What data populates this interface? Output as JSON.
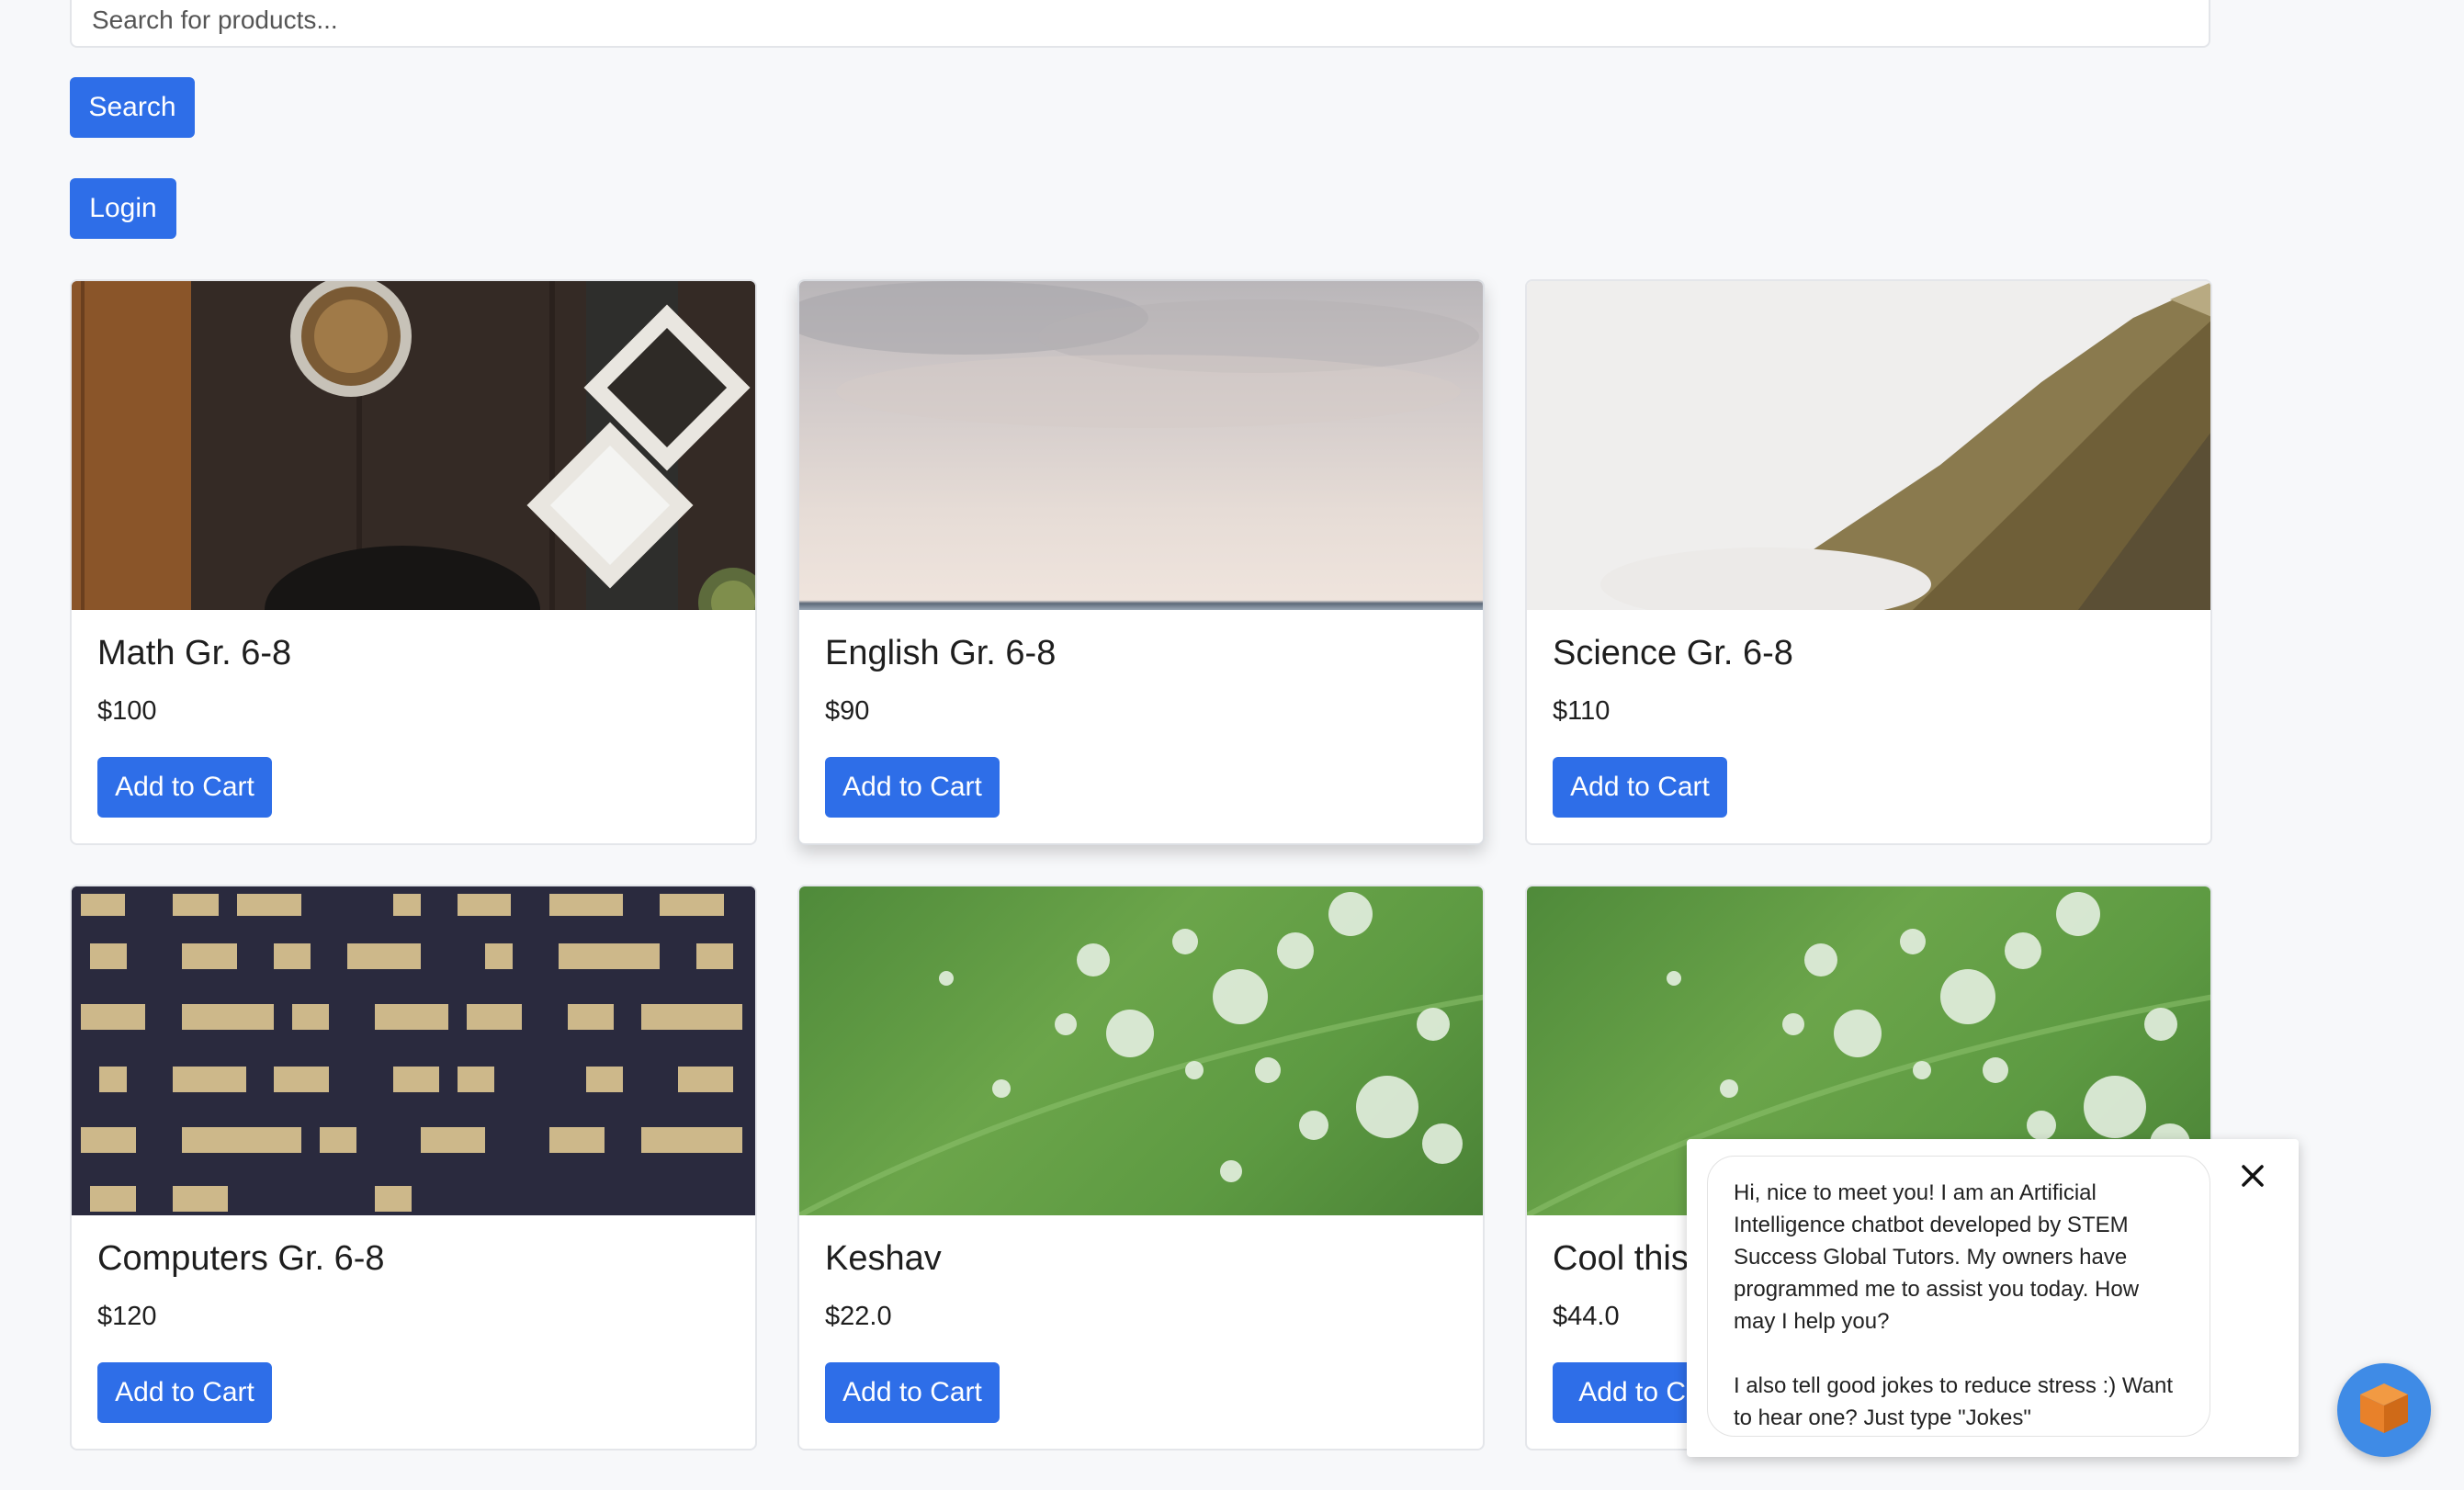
{
  "search": {
    "placeholder": "Search for products...",
    "button_label": "Search"
  },
  "auth": {
    "login_label": "Login"
  },
  "products": [
    {
      "title": "Math Gr. 6-8",
      "price": "$100",
      "cta": "Add to Cart",
      "image": "spices-on-dark-table-photo"
    },
    {
      "title": "English Gr. 6-8",
      "price": "$90",
      "cta": "Add to Cart",
      "image": "hazy-sky-photo"
    },
    {
      "title": "Science Gr. 6-8",
      "price": "$110",
      "cta": "Add to Cart",
      "image": "misty-forest-hillside-photo"
    },
    {
      "title": "Computers Gr. 6-8",
      "price": "$120",
      "cta": "Add to Cart",
      "image": "office-building-night-windows-photo"
    },
    {
      "title": "Keshav",
      "price": "$22.0",
      "cta": "Add to Cart",
      "image": "leaf-water-droplets-photo"
    },
    {
      "title": "Cool this",
      "price": "$44.0",
      "cta": "Add to Ca",
      "image": "leaf-water-droplets-photo"
    }
  ],
  "chatbot": {
    "message": "Hi, nice to meet you! I am an Artificial Intelligence chatbot developed by STEM Success Global Tutors. My owners have programmed me to assist you today. How may I help you?\n\nI also tell good jokes to reduce stress :) Want to hear one? Just type \"Jokes\"",
    "close_icon": "close-icon",
    "launcher_icon": "cube-icon"
  },
  "colors": {
    "primary": "#2e6ee8",
    "background": "#f7f8fa",
    "launcher": "#3f8be6",
    "launcher_cube": "#e8812a"
  }
}
